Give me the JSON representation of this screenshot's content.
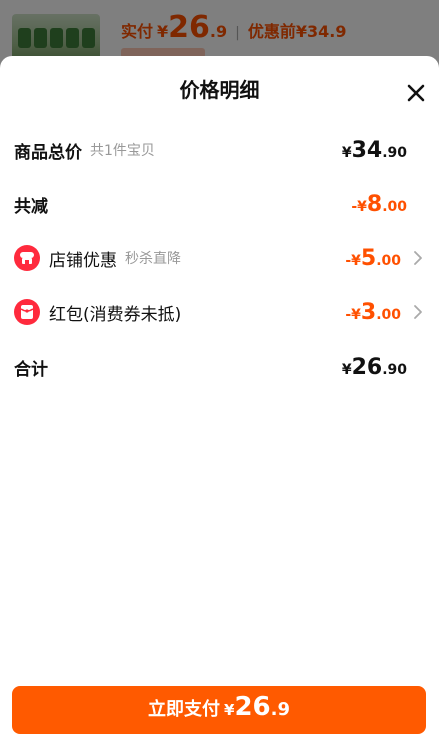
{
  "background": {
    "paid_label": "实付",
    "currency": "¥",
    "paid_int": "26",
    "paid_dec": ".9",
    "separator": "|",
    "before_label": "优惠前",
    "before_price": "¥34.9"
  },
  "sheet": {
    "title": "价格明细"
  },
  "rows": {
    "total": {
      "label": "商品总价",
      "sub": "共1件宝贝",
      "currency": "¥",
      "int": "34",
      "dec": ".90"
    },
    "reduce": {
      "label": "共减",
      "prefix": "-¥",
      "int": "8",
      "dec": ".00"
    },
    "shop": {
      "label": "店铺优惠",
      "sub": "秒杀直降",
      "prefix": "-¥",
      "int": "5",
      "dec": ".00"
    },
    "redpacket": {
      "label": "红包(消费券未抵)",
      "prefix": "-¥",
      "int": "3",
      "dec": ".00"
    },
    "sum": {
      "label": "合计",
      "currency": "¥",
      "int": "26",
      "dec": ".90"
    }
  },
  "pay_button": {
    "label": "立即支付",
    "currency": "¥",
    "int": "26",
    "dec": ".9"
  },
  "colors": {
    "accent": "#ff5000",
    "button": "#ff5a00",
    "icon_red": "#ff2a3d"
  },
  "icons": {
    "close": "close-icon",
    "shop": "shop-icon",
    "redpacket": "red-packet-icon",
    "chevron": "chevron-right-icon"
  }
}
